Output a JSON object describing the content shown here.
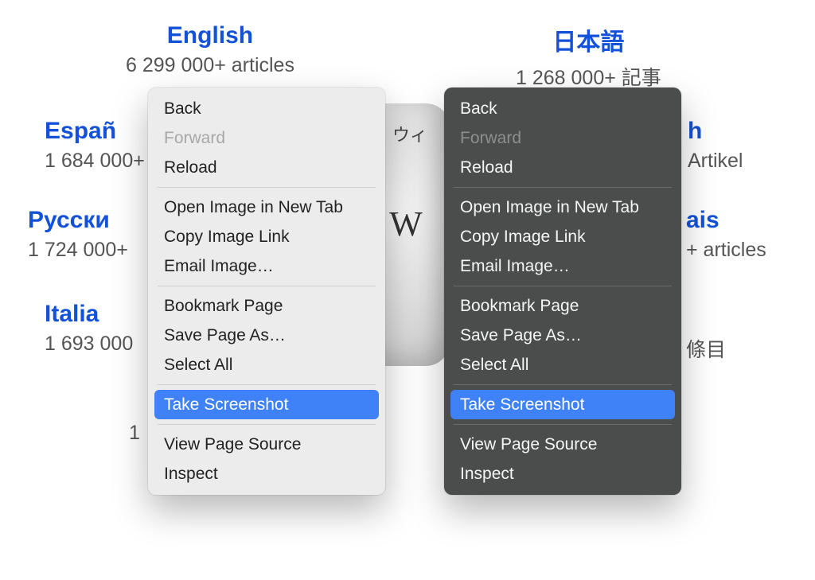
{
  "languages": {
    "english": {
      "name": "English",
      "sub": "6 299 000+ articles"
    },
    "japanese": {
      "name": "日本語",
      "sub": "1 268 000+ 記事"
    },
    "spanish": {
      "name": "Españ",
      "sub": "1 684 000+"
    },
    "german_tail": {
      "name": "h",
      "sub": "Artikel"
    },
    "russian": {
      "name": "Русски",
      "sub": "1 724 000+ "
    },
    "french_tail": {
      "name": "ais",
      "sub": "+ articles"
    },
    "italian": {
      "name": "Italia",
      "sub": "1 693 000"
    },
    "chinese_tail": {
      "sub": "條目"
    },
    "portuguese_frag": {
      "sub": "1 "
    }
  },
  "globe": {
    "letter": "W",
    "kana": "ウィ"
  },
  "menu": {
    "back": "Back",
    "forward": "Forward",
    "reload": "Reload",
    "open_image": "Open Image in New Tab",
    "copy_image_link": "Copy Image Link",
    "email_image": "Email Image…",
    "bookmark_page": "Bookmark Page",
    "save_page_as": "Save Page As…",
    "select_all": "Select All",
    "take_screenshot": "Take Screenshot",
    "view_source": "View Page Source",
    "inspect": "Inspect"
  }
}
